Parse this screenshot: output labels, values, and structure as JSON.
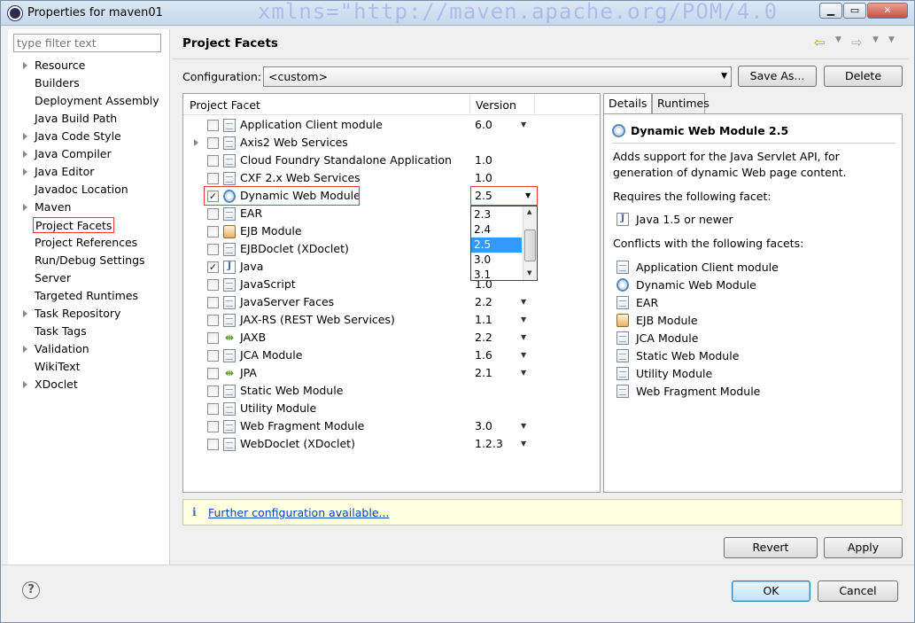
{
  "window": {
    "title": "Properties for maven01",
    "background_watermark": "xmlns=\"http://maven.apache.org/POM/4.0"
  },
  "sidebar": {
    "filter_placeholder": "type filter text",
    "items": [
      {
        "label": "Resource",
        "expandable": true
      },
      {
        "label": "Builders",
        "expandable": false
      },
      {
        "label": "Deployment Assembly",
        "expandable": false
      },
      {
        "label": "Java Build Path",
        "expandable": false
      },
      {
        "label": "Java Code Style",
        "expandable": true
      },
      {
        "label": "Java Compiler",
        "expandable": true
      },
      {
        "label": "Java Editor",
        "expandable": true
      },
      {
        "label": "Javadoc Location",
        "expandable": false
      },
      {
        "label": "Maven",
        "expandable": true
      },
      {
        "label": "Project Facets",
        "expandable": false,
        "selected": true
      },
      {
        "label": "Project References",
        "expandable": false
      },
      {
        "label": "Run/Debug Settings",
        "expandable": false
      },
      {
        "label": "Server",
        "expandable": false
      },
      {
        "label": "Targeted Runtimes",
        "expandable": false
      },
      {
        "label": "Task Repository",
        "expandable": true
      },
      {
        "label": "Task Tags",
        "expandable": false
      },
      {
        "label": "Validation",
        "expandable": true
      },
      {
        "label": "WikiText",
        "expandable": false
      },
      {
        "label": "XDoclet",
        "expandable": true
      }
    ]
  },
  "page": {
    "heading": "Project Facets",
    "configuration_label": "Configuration:",
    "configuration_value": "<custom>",
    "save_as_label": "Save As...",
    "delete_label": "Delete"
  },
  "facets": {
    "col_facet": "Project Facet",
    "col_version": "Version",
    "rows": [
      {
        "name": "Application Client module",
        "version": "6.0",
        "checked": false,
        "has_dropdown": true,
        "icon": "doc-icon"
      },
      {
        "name": "Axis2 Web Services",
        "version": "",
        "checked": false,
        "has_dropdown": false,
        "icon": "doc-icon",
        "expandable": true
      },
      {
        "name": "Cloud Foundry Standalone Application",
        "version": "1.0",
        "checked": false,
        "has_dropdown": false,
        "icon": "doc-icon"
      },
      {
        "name": "CXF 2.x Web Services",
        "version": "1.0",
        "checked": false,
        "has_dropdown": false,
        "icon": "doc-icon"
      },
      {
        "name": "Dynamic Web Module",
        "version": "2.5",
        "checked": true,
        "has_dropdown": true,
        "icon": "gear-icon",
        "highlighted": true
      },
      {
        "name": "EAR",
        "version": "",
        "checked": false,
        "has_dropdown": false,
        "icon": "doc-icon"
      },
      {
        "name": "EJB Module",
        "version": "",
        "checked": false,
        "has_dropdown": false,
        "icon": "ejb-icon"
      },
      {
        "name": "EJBDoclet (XDoclet)",
        "version": "",
        "checked": false,
        "has_dropdown": false,
        "icon": "doc-icon"
      },
      {
        "name": "Java",
        "version": "",
        "checked": true,
        "has_dropdown": false,
        "icon": "java-icon"
      },
      {
        "name": "JavaScript",
        "version": "1.0",
        "checked": false,
        "has_dropdown": false,
        "icon": "doc-icon"
      },
      {
        "name": "JavaServer Faces",
        "version": "2.2",
        "checked": false,
        "has_dropdown": true,
        "icon": "doc-icon"
      },
      {
        "name": "JAX-RS (REST Web Services)",
        "version": "1.1",
        "checked": false,
        "has_dropdown": true,
        "icon": "doc-icon"
      },
      {
        "name": "JAXB",
        "version": "2.2",
        "checked": false,
        "has_dropdown": true,
        "icon": "xml-icon"
      },
      {
        "name": "JCA Module",
        "version": "1.6",
        "checked": false,
        "has_dropdown": true,
        "icon": "doc-icon"
      },
      {
        "name": "JPA",
        "version": "2.1",
        "checked": false,
        "has_dropdown": true,
        "icon": "xml-icon"
      },
      {
        "name": "Static Web Module",
        "version": "",
        "checked": false,
        "has_dropdown": false,
        "icon": "doc-icon"
      },
      {
        "name": "Utility Module",
        "version": "",
        "checked": false,
        "has_dropdown": false,
        "icon": "doc-icon"
      },
      {
        "name": "Web Fragment Module",
        "version": "3.0",
        "checked": false,
        "has_dropdown": true,
        "icon": "doc-icon"
      },
      {
        "name": "WebDoclet (XDoclet)",
        "version": "1.2.3",
        "checked": false,
        "has_dropdown": true,
        "icon": "doc-icon"
      }
    ],
    "version_dropdown": {
      "options": [
        "2.3",
        "2.4",
        "2.5",
        "3.0",
        "3.1"
      ],
      "selected": "2.5"
    }
  },
  "details": {
    "tab_details": "Details",
    "tab_runtimes": "Runtimes",
    "title": "Dynamic Web Module 2.5",
    "description_line1": "Adds support for the Java Servlet API, for",
    "description_line2": "generation of dynamic Web page content.",
    "requires_label": "Requires the following facet:",
    "requires": [
      "Java 1.5 or newer"
    ],
    "conflicts_label": "Conflicts with the following facets:",
    "conflicts": [
      "Application Client module",
      "Dynamic Web Module",
      "EAR",
      "EJB Module",
      "JCA Module",
      "Static Web Module",
      "Utility Module",
      "Web Fragment Module"
    ]
  },
  "info": {
    "link": "Further configuration available..."
  },
  "buttons": {
    "revert": "Revert",
    "apply": "Apply",
    "ok": "OK",
    "cancel": "Cancel"
  }
}
